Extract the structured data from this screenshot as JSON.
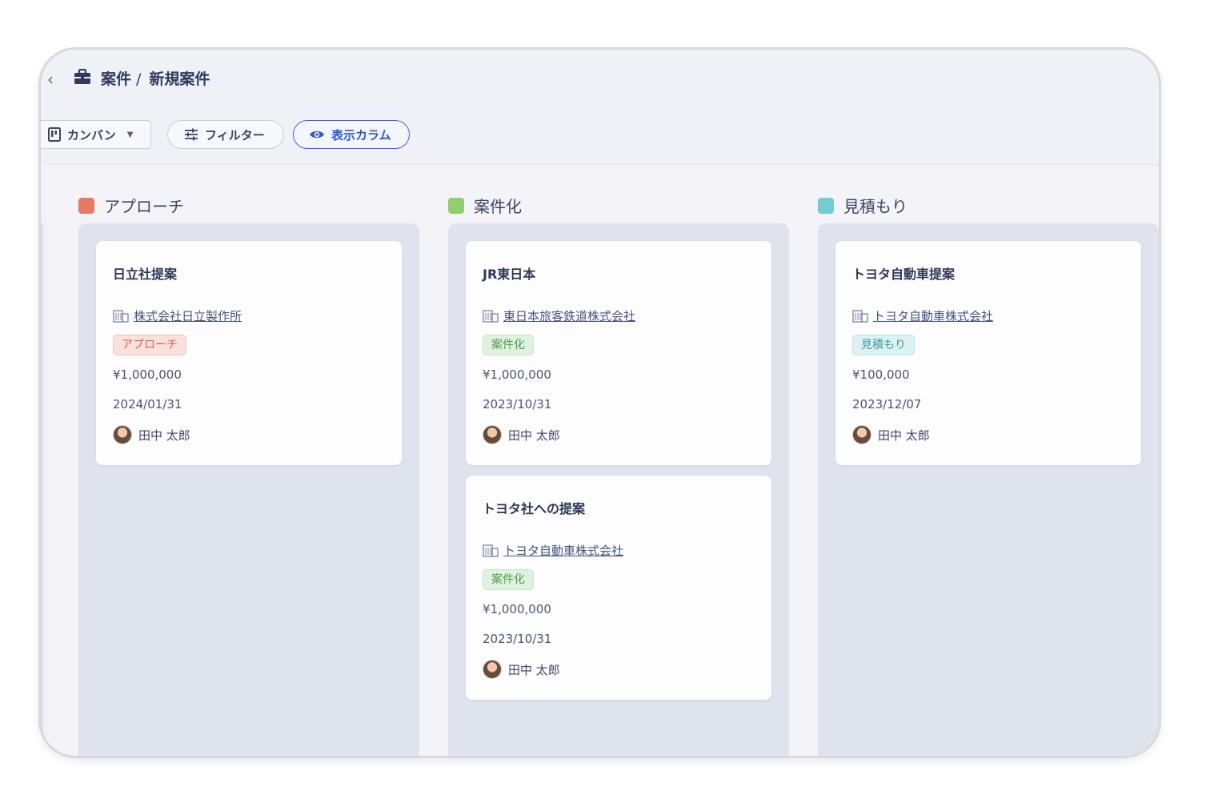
{
  "breadcrumb": {
    "parent": "案件",
    "separator": "/",
    "current": "新規案件"
  },
  "toolbar": {
    "kanban": "カンバン",
    "filter": "フィルター",
    "columns": "表示カラム"
  },
  "columns": [
    {
      "label": "アプローチ",
      "color": "#e57a63"
    },
    {
      "label": "案件化",
      "color": "#8fcf72"
    },
    {
      "label": "見積もり",
      "color": "#74cbd0"
    }
  ],
  "cards": [
    {
      "title": "日立社提案",
      "company": "株式会社日立製作所",
      "status": "アプローチ",
      "amount": "¥1,000,000",
      "date": "2024/01/31",
      "owner": "田中 太郎"
    },
    {
      "title": "JR東日本",
      "company": "東日本旅客鉄道株式会社",
      "status": "案件化",
      "amount": "¥1,000,000",
      "date": "2023/10/31",
      "owner": "田中 太郎"
    },
    {
      "title": "トヨタ社への提案",
      "company": "トヨタ自動車株式会社",
      "status": "案件化",
      "amount": "¥1,000,000",
      "date": "2023/10/31",
      "owner": "田中 太郎"
    },
    {
      "title": "トヨタ自動車提案",
      "company": "トヨタ自動車株式会社",
      "status": "見積もり",
      "amount": "¥100,000",
      "date": "2023/12/07",
      "owner": "田中 太郎"
    }
  ]
}
